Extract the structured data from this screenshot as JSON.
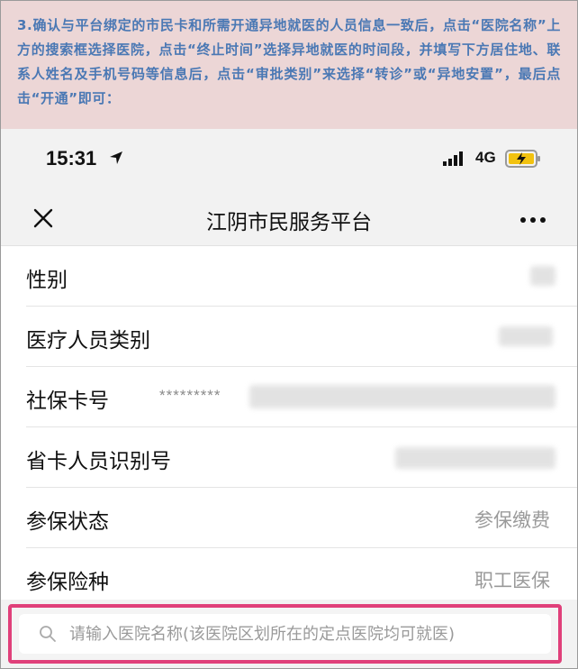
{
  "instruction": {
    "text": "3.确认与平台绑定的市民卡和所需开通异地就医的人员信息一致后，点击“医院名称”上方的搜索框选择医院，点击“终止时间”选择异地就医的时间段，并填写下方居住地、联系人姓名及手机号码等信息后，点击“审批类别”来选择“转诊”或“异地安置”，最后点击“开通”即可：",
    "color": "#4a78b4",
    "background": "#ecd6d6"
  },
  "status_bar": {
    "time": "15:31",
    "network": "4G",
    "icons": [
      "location-arrow-icon",
      "signal-icon",
      "battery-charging-icon"
    ]
  },
  "nav": {
    "title": "江阴市民服务平台",
    "close_icon": "close-icon",
    "more_icon": "more-icon"
  },
  "fields": [
    {
      "label": "性别",
      "value": "",
      "blurred": true
    },
    {
      "label": "医疗人员类别",
      "value": "",
      "blurred": true
    },
    {
      "label": "社保卡号",
      "masked": "*********",
      "value": "",
      "blurred": true
    },
    {
      "label": "省卡人员识别号",
      "value": "",
      "blurred": true
    },
    {
      "label": "参保状态",
      "value": "参保缴费"
    },
    {
      "label": "参保险种",
      "value": "职工医保"
    }
  ],
  "search": {
    "placeholder": "请输入医院名称(该医院区划所在的定点医院均可就医)",
    "highlight_color": "#e0407a"
  }
}
